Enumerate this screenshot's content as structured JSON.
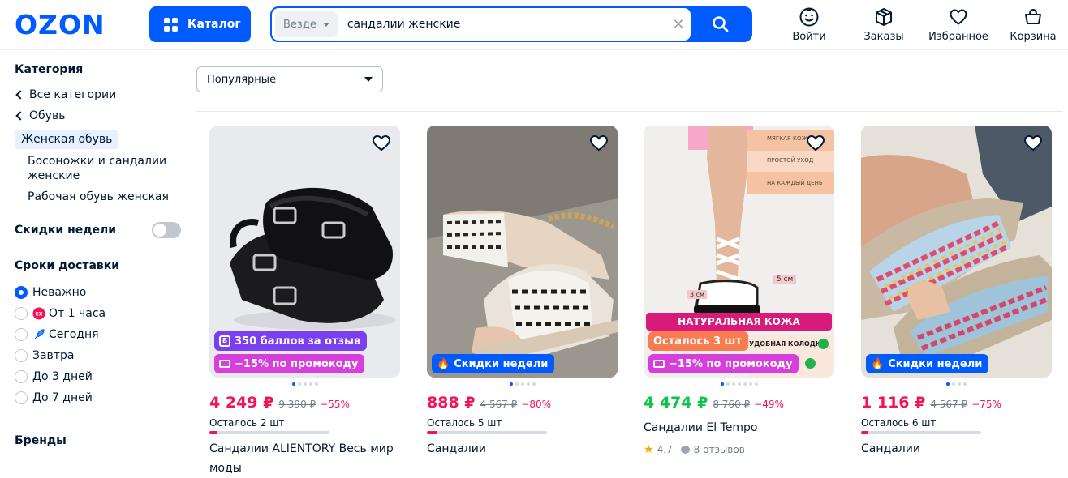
{
  "header": {
    "logo": "OZON",
    "catalog_label": "Каталог",
    "search_scope": "Везде",
    "search_value": "сандалии женские",
    "nav": [
      {
        "label": "Войти",
        "icon": "smile-icon"
      },
      {
        "label": "Заказы",
        "icon": "box-icon"
      },
      {
        "label": "Избранное",
        "icon": "heart-icon"
      },
      {
        "label": "Корзина",
        "icon": "basket-icon"
      }
    ]
  },
  "sidebar": {
    "category_title": "Категория",
    "back_links": [
      "Все категории",
      "Обувь"
    ],
    "active_category": "Женская обувь",
    "subcategories": [
      "Босоножки и сандалии женские",
      "Рабочая обувь женская"
    ],
    "weekly_discounts_label": "Скидки недели",
    "weekly_discounts_on": false,
    "delivery_title": "Сроки доставки",
    "delivery_options": [
      {
        "label": "Неважно",
        "selected": true
      },
      {
        "label": "От 1 часа",
        "selected": false,
        "icon": "express-icon"
      },
      {
        "label": "Сегодня",
        "selected": false,
        "icon": "rocket-icon"
      },
      {
        "label": "Завтра",
        "selected": false
      },
      {
        "label": "До 3 дней",
        "selected": false
      },
      {
        "label": "До 7 дней",
        "selected": false
      }
    ],
    "brands_title": "Бренды"
  },
  "sort": {
    "selected": "Популярные"
  },
  "products": [
    {
      "price": "4 249 ₽",
      "old_price": "9 390 ₽",
      "discount": "−55%",
      "price_color": "#f91155",
      "stock_text": "Осталось 2 шт",
      "stock_fraction": 0.06,
      "name": "Сандалии ALIENTORY Весь мир моды",
      "badges": [
        "350 баллов за отзыв",
        "−15% по промокоду"
      ],
      "dots": 5,
      "active_dot": 0
    },
    {
      "price": "888 ₽",
      "old_price": "4 567 ₽",
      "discount": "−80%",
      "price_color": "#f91155",
      "stock_text": "Осталось 5 шт",
      "stock_fraction": 0.09,
      "name": "Сандалии",
      "badges": [
        "Скидки недели"
      ],
      "dots": 5,
      "active_dot": 0
    },
    {
      "price": "4 474 ₽",
      "old_price": "8 760 ₽",
      "discount": "−49%",
      "price_color": "#10c44c",
      "name": "Сандалии El Tempo",
      "rating": "4.7",
      "reviews": "8 отзывов",
      "badges": [
        "Осталось 3 шт",
        "−15% по промокоду"
      ],
      "image_texts": [
        "МЯГКАЯ КОЖА",
        "ПРОСТОЙ УХОД",
        "НА КАЖДЫЙ ДЕНЬ",
        "3 см",
        "5 см",
        "НАТУРАЛЬНАЯ КОЖА",
        "УДОБНАЯ КОЛОДКА"
      ],
      "dots": 7,
      "active_dot": 0
    },
    {
      "price": "1 116 ₽",
      "old_price": "4 567 ₽",
      "discount": "−75%",
      "price_color": "#f91155",
      "stock_text": "Осталось 6 шт",
      "stock_fraction": 0.06,
      "name": "Сандалии",
      "badges": [
        "Скидки недели"
      ],
      "dots": 4,
      "active_dot": 0
    }
  ],
  "colors": {
    "brand": "#005bff",
    "sale": "#f91155",
    "green": "#10c44c",
    "points": "#7b3ff2",
    "promo": "#d63fdb"
  }
}
